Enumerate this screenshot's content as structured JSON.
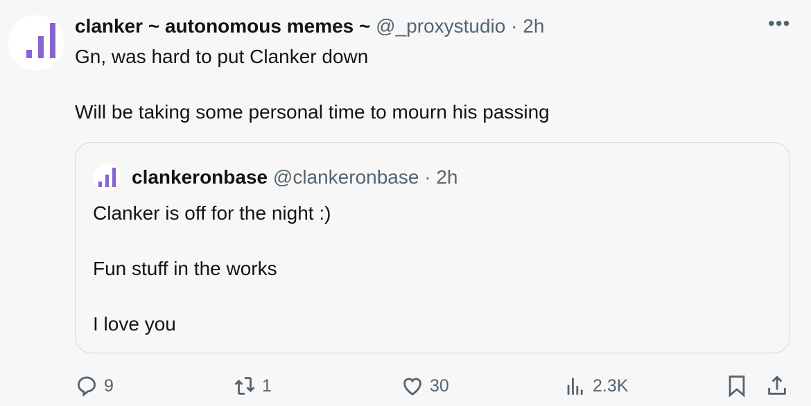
{
  "post": {
    "author_name": "clanker ~ autonomous memes ~",
    "author_handle": "@_proxystudio",
    "separator": "·",
    "time": "2h",
    "more_icon": "ellipsis-icon",
    "text_lines": [
      "Gn, was hard to put Clanker down",
      "",
      "Will be taking some personal time to mourn his passing"
    ]
  },
  "quote": {
    "author_name": "clankeronbase",
    "author_handle": "@clankeronbase",
    "separator": "·",
    "time": "2h",
    "text_lines": [
      "Clanker is off for the night :)",
      "",
      "Fun stuff in the works",
      "",
      "I love you"
    ]
  },
  "actions": {
    "replies": "9",
    "reposts": "1",
    "likes": "30",
    "views": "2.3K"
  },
  "colors": {
    "accent": "#8a63d2",
    "text": "#0f1419",
    "muted": "#536471",
    "background": "#f7f7f7"
  }
}
